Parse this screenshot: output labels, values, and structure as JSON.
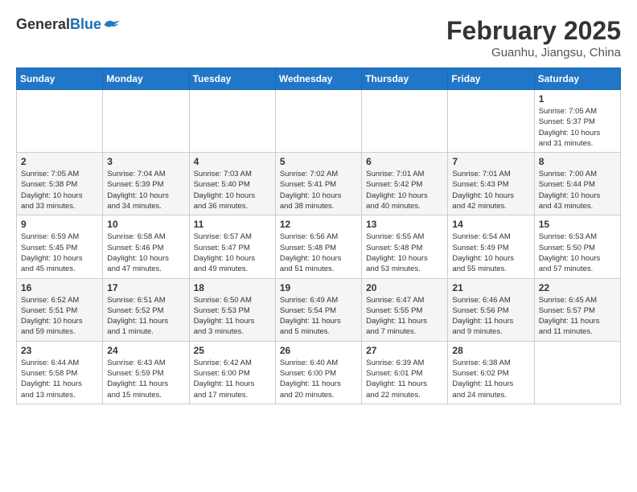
{
  "header": {
    "logo_general": "General",
    "logo_blue": "Blue",
    "month_title": "February 2025",
    "subtitle": "Guanhu, Jiangsu, China"
  },
  "weekdays": [
    "Sunday",
    "Monday",
    "Tuesday",
    "Wednesday",
    "Thursday",
    "Friday",
    "Saturday"
  ],
  "weeks": [
    [
      {
        "day": "",
        "info": ""
      },
      {
        "day": "",
        "info": ""
      },
      {
        "day": "",
        "info": ""
      },
      {
        "day": "",
        "info": ""
      },
      {
        "day": "",
        "info": ""
      },
      {
        "day": "",
        "info": ""
      },
      {
        "day": "1",
        "info": "Sunrise: 7:05 AM\nSunset: 5:37 PM\nDaylight: 10 hours\nand 31 minutes."
      }
    ],
    [
      {
        "day": "2",
        "info": "Sunrise: 7:05 AM\nSunset: 5:38 PM\nDaylight: 10 hours\nand 33 minutes."
      },
      {
        "day": "3",
        "info": "Sunrise: 7:04 AM\nSunset: 5:39 PM\nDaylight: 10 hours\nand 34 minutes."
      },
      {
        "day": "4",
        "info": "Sunrise: 7:03 AM\nSunset: 5:40 PM\nDaylight: 10 hours\nand 36 minutes."
      },
      {
        "day": "5",
        "info": "Sunrise: 7:02 AM\nSunset: 5:41 PM\nDaylight: 10 hours\nand 38 minutes."
      },
      {
        "day": "6",
        "info": "Sunrise: 7:01 AM\nSunset: 5:42 PM\nDaylight: 10 hours\nand 40 minutes."
      },
      {
        "day": "7",
        "info": "Sunrise: 7:01 AM\nSunset: 5:43 PM\nDaylight: 10 hours\nand 42 minutes."
      },
      {
        "day": "8",
        "info": "Sunrise: 7:00 AM\nSunset: 5:44 PM\nDaylight: 10 hours\nand 43 minutes."
      }
    ],
    [
      {
        "day": "9",
        "info": "Sunrise: 6:59 AM\nSunset: 5:45 PM\nDaylight: 10 hours\nand 45 minutes."
      },
      {
        "day": "10",
        "info": "Sunrise: 6:58 AM\nSunset: 5:46 PM\nDaylight: 10 hours\nand 47 minutes."
      },
      {
        "day": "11",
        "info": "Sunrise: 6:57 AM\nSunset: 5:47 PM\nDaylight: 10 hours\nand 49 minutes."
      },
      {
        "day": "12",
        "info": "Sunrise: 6:56 AM\nSunset: 5:48 PM\nDaylight: 10 hours\nand 51 minutes."
      },
      {
        "day": "13",
        "info": "Sunrise: 6:55 AM\nSunset: 5:48 PM\nDaylight: 10 hours\nand 53 minutes."
      },
      {
        "day": "14",
        "info": "Sunrise: 6:54 AM\nSunset: 5:49 PM\nDaylight: 10 hours\nand 55 minutes."
      },
      {
        "day": "15",
        "info": "Sunrise: 6:53 AM\nSunset: 5:50 PM\nDaylight: 10 hours\nand 57 minutes."
      }
    ],
    [
      {
        "day": "16",
        "info": "Sunrise: 6:52 AM\nSunset: 5:51 PM\nDaylight: 10 hours\nand 59 minutes."
      },
      {
        "day": "17",
        "info": "Sunrise: 6:51 AM\nSunset: 5:52 PM\nDaylight: 11 hours\nand 1 minute."
      },
      {
        "day": "18",
        "info": "Sunrise: 6:50 AM\nSunset: 5:53 PM\nDaylight: 11 hours\nand 3 minutes."
      },
      {
        "day": "19",
        "info": "Sunrise: 6:49 AM\nSunset: 5:54 PM\nDaylight: 11 hours\nand 5 minutes."
      },
      {
        "day": "20",
        "info": "Sunrise: 6:47 AM\nSunset: 5:55 PM\nDaylight: 11 hours\nand 7 minutes."
      },
      {
        "day": "21",
        "info": "Sunrise: 6:46 AM\nSunset: 5:56 PM\nDaylight: 11 hours\nand 9 minutes."
      },
      {
        "day": "22",
        "info": "Sunrise: 6:45 AM\nSunset: 5:57 PM\nDaylight: 11 hours\nand 11 minutes."
      }
    ],
    [
      {
        "day": "23",
        "info": "Sunrise: 6:44 AM\nSunset: 5:58 PM\nDaylight: 11 hours\nand 13 minutes."
      },
      {
        "day": "24",
        "info": "Sunrise: 6:43 AM\nSunset: 5:59 PM\nDaylight: 11 hours\nand 15 minutes."
      },
      {
        "day": "25",
        "info": "Sunrise: 6:42 AM\nSunset: 6:00 PM\nDaylight: 11 hours\nand 17 minutes."
      },
      {
        "day": "26",
        "info": "Sunrise: 6:40 AM\nSunset: 6:00 PM\nDaylight: 11 hours\nand 20 minutes."
      },
      {
        "day": "27",
        "info": "Sunrise: 6:39 AM\nSunset: 6:01 PM\nDaylight: 11 hours\nand 22 minutes."
      },
      {
        "day": "28",
        "info": "Sunrise: 6:38 AM\nSunset: 6:02 PM\nDaylight: 11 hours\nand 24 minutes."
      },
      {
        "day": "",
        "info": ""
      }
    ]
  ]
}
